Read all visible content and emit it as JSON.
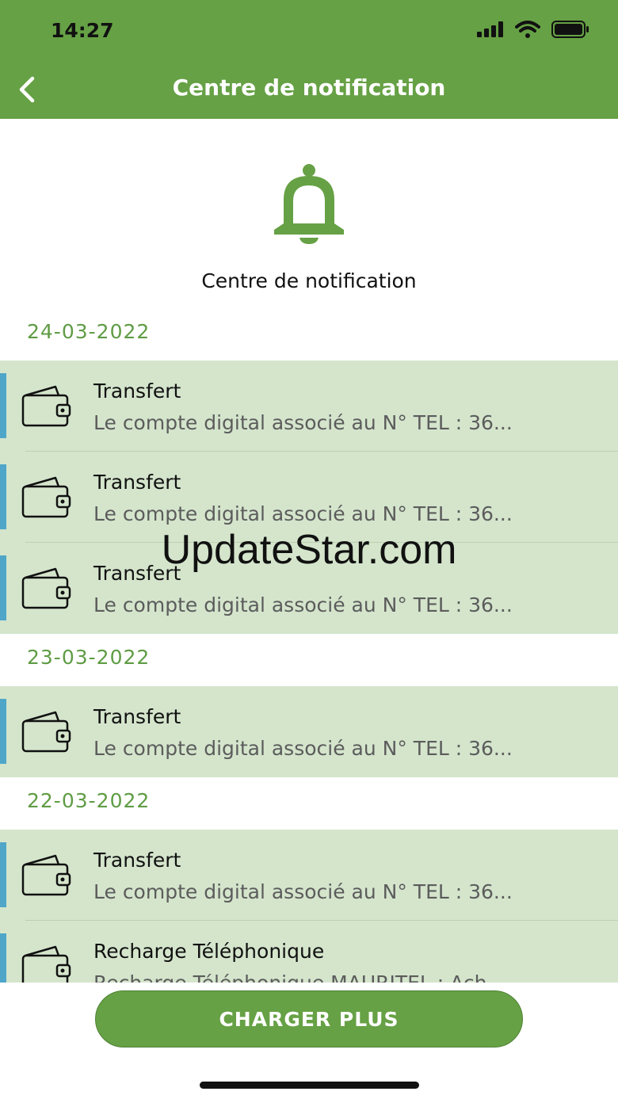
{
  "status_bar": {
    "time": "14:27",
    "icons": [
      "signal-icon",
      "wifi-icon",
      "battery-icon"
    ]
  },
  "header": {
    "title": "Centre de notification",
    "back_icon": "chevron-left-icon",
    "color": "#66a145"
  },
  "hero": {
    "icon": "bell-icon",
    "title": "Centre de notification"
  },
  "groups": [
    {
      "date": "24-03-2022",
      "items": [
        {
          "title": "Transfert",
          "description": "Le compte digital associé au N° TEL : 36..."
        },
        {
          "title": "Transfert",
          "description": "Le compte digital associé au N° TEL : 36..."
        },
        {
          "title": "Transfert",
          "description": "Le compte digital associé au N° TEL : 36..."
        }
      ]
    },
    {
      "date": "23-03-2022",
      "items": [
        {
          "title": "Transfert",
          "description": "Le compte digital associé au N° TEL : 36..."
        }
      ]
    },
    {
      "date": "22-03-2022",
      "items": [
        {
          "title": "Transfert",
          "description": "Le compte digital associé au N° TEL : 36..."
        },
        {
          "title": "Recharge Téléphonique",
          "description": "Recharge Téléphonique MAURITEL : Ach..."
        }
      ]
    }
  ],
  "item_icon": "wallet-icon",
  "watermark": "UpdateStar.com",
  "footer": {
    "load_more_label": "CHARGER PLUS"
  },
  "colors": {
    "accent_green": "#66a145",
    "date_green": "#5f9c45",
    "item_background": "#d4e5cc",
    "item_accent": "#4fa6c9"
  }
}
